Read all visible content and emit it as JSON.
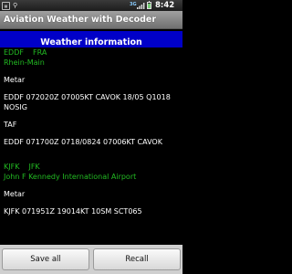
{
  "status_bar": {
    "network_type": "3G",
    "time": "8:42 PM",
    "colors": {
      "network": "#88ccff",
      "battery": "#77cc77"
    }
  },
  "app": {
    "title": "Aviation Weather with Decoder"
  },
  "header": {
    "title": "Weather information",
    "color": "#0000c8"
  },
  "stations": [
    {
      "icao": "EDDF",
      "iata": "FRA",
      "name": "Rhein-Main",
      "metar_label": "Metar",
      "metar": "EDDF 072020Z 07005KT CAVOK 18/05 Q1018 NOSIG",
      "taf_label": "TAF",
      "taf": "EDDF 071700Z 0718/0824 07006KT CAVOK"
    },
    {
      "icao": "KJFK",
      "iata": "JFK",
      "name": "John F Kennedy International Airport",
      "metar_label": "Metar",
      "metar": "KJFK 071951Z 19014KT 10SM SCT065"
    }
  ],
  "buttons": {
    "save_all": "Save all",
    "recall": "Recall"
  },
  "theme": {
    "station_color": "#22bb22"
  }
}
